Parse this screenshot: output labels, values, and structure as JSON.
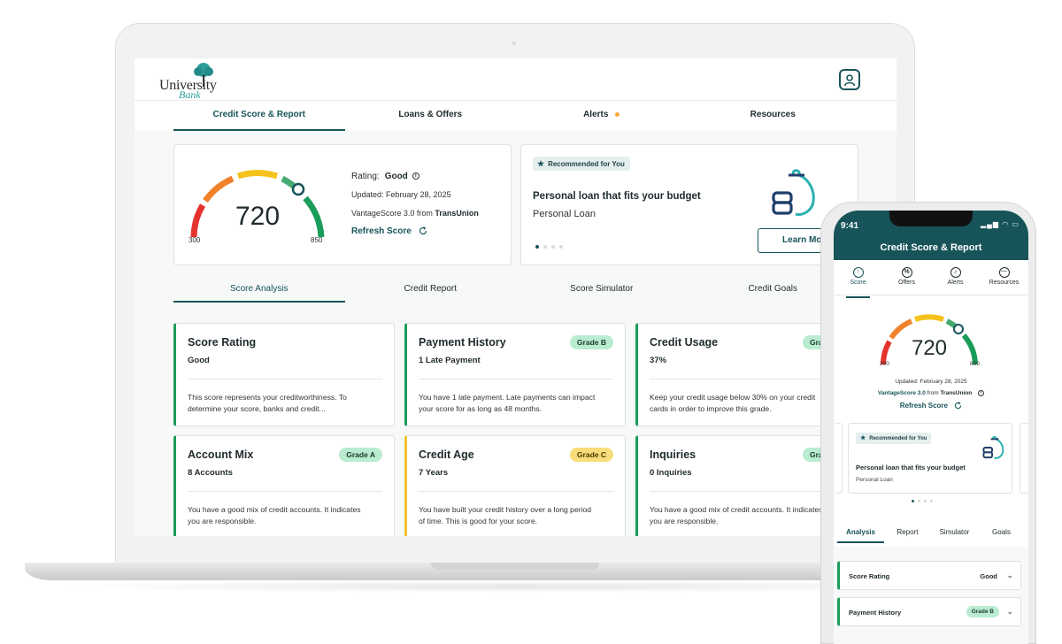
{
  "brand": {
    "logo_main": "University",
    "logo_sub": "Bank",
    "accent": "#17545a"
  },
  "topnav": {
    "tabs": [
      "Credit Score & Report",
      "Loans & Offers",
      "Alerts",
      "Resources"
    ],
    "active": "Credit Score & Report"
  },
  "score": {
    "value": "720",
    "min": "300",
    "max": "850",
    "rating_label": "Rating:",
    "rating": "Good",
    "updated": "Updated: February 28, 2025",
    "model": "VantageScore 3.0 from",
    "bureau": "TransUnion",
    "refresh": "Refresh Score"
  },
  "offer": {
    "tag": "Recommended for You",
    "title": "Personal loan that fits your budget",
    "subtitle": "Personal Loan",
    "cta": "Learn More",
    "pages": 4,
    "current_page": 1
  },
  "subnav": {
    "tabs": [
      "Score Analysis",
      "Credit Report",
      "Score Simulator",
      "Credit Goals"
    ],
    "active": "Score Analysis"
  },
  "cards": [
    {
      "title": "Score Rating",
      "value": "Good",
      "grade": "",
      "desc1": "This score represents your creditworthiness. To",
      "desc2": "determine your score, banks and credit..."
    },
    {
      "title": "Payment History",
      "value": "1 Late Payment",
      "grade": "Grade B",
      "desc1": "You have 1 late payment. Late payments can impact",
      "desc2": "your score for as long as 48 months."
    },
    {
      "title": "Credit Usage",
      "value": "37%",
      "grade": "Grade",
      "desc1": "Keep your credit usage below 30% on your credit",
      "desc2": "cards in order to improve this grade."
    },
    {
      "title": "Account Mix",
      "value": "8 Accounts",
      "grade": "Grade A",
      "desc1": "You have a good mix of credit accounts. It indicates",
      "desc2": "you are responsible."
    },
    {
      "title": "Credit Age",
      "value": "7 Years",
      "grade": "Grade C",
      "desc1": "You have built your credit history over a long period",
      "desc2": "of time. This is good for your score."
    },
    {
      "title": "Inquiries",
      "value": "0 Inquiries",
      "grade": "Grade",
      "desc1": "You have a good mix of credit accounts. It indicates",
      "desc2": "you are responsible."
    }
  ],
  "phone": {
    "time": "9:41",
    "title": "Credit Score & Report",
    "nav": [
      "Score",
      "Offers",
      "Alerts",
      "Resources"
    ],
    "score": "720",
    "min": "300",
    "max": "850",
    "updated": "Updated: February 28, 2025",
    "model": "VantageScore 3.0",
    "model_from": "from",
    "bureau": "TransUnion",
    "refresh": "Refresh Score",
    "offer_tag": "Recommended for You",
    "offer_title": "Personal loan that fits your budget",
    "offer_sub": "Personal Loan",
    "subnav": [
      "Analysis",
      "Report",
      "Simulator",
      "Goals"
    ],
    "rows": [
      {
        "label": "Score Rating",
        "value": "Good"
      },
      {
        "label": "Payment History",
        "value": "Grade B"
      }
    ]
  }
}
